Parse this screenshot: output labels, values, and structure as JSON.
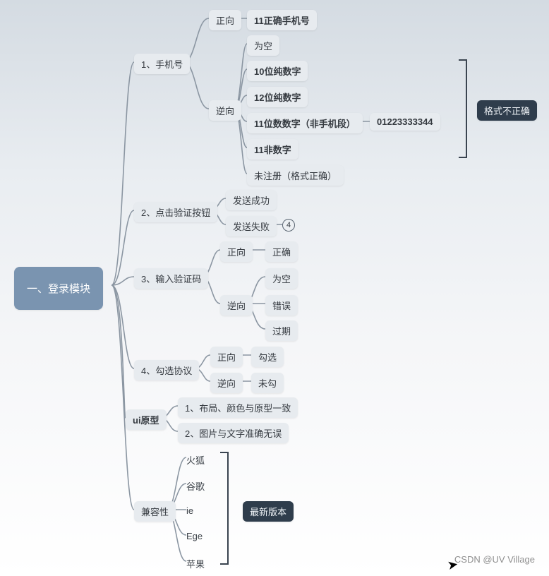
{
  "root": "一、登录模块",
  "phone": {
    "title": "1、手机号",
    "pos": {
      "title": "正向",
      "case1": "11正确手机号"
    },
    "neg": {
      "title": "逆向",
      "empty": "为空",
      "ten": "10位纯数字",
      "twelve": "12位纯数字",
      "eleven_nonseg": "11位数数字（非手机段）",
      "eleven_nonseg_ex": "01223333344",
      "nondigit": "11非数字",
      "unreg": "未注册（格式正确）"
    },
    "summary": "格式不正确"
  },
  "verifyBtn": {
    "title": "2、点击验证按钮",
    "ok": "发送成功",
    "fail": "发送失败",
    "failCount": "4"
  },
  "code": {
    "title": "3、输入验证码",
    "pos": {
      "title": "正向",
      "ok": "正确"
    },
    "neg": {
      "title": "逆向",
      "empty": "为空",
      "wrong": "错误",
      "expired": "过期"
    }
  },
  "agree": {
    "title": "4、勾选协议",
    "pos": {
      "title": "正向",
      "val": "勾选"
    },
    "neg": {
      "title": "逆向",
      "val": "未勾"
    }
  },
  "ui": {
    "title": "ui原型",
    "l1": "1、布局、颜色与原型一致",
    "l2": "2、图片与文字准确无误"
  },
  "compat": {
    "title": "兼容性",
    "b1": "火狐",
    "b2": "谷歌",
    "b3": "ie",
    "b4": "Ege",
    "b5": "苹果",
    "note": "最新版本"
  },
  "watermark": "CSDN @UV Village"
}
